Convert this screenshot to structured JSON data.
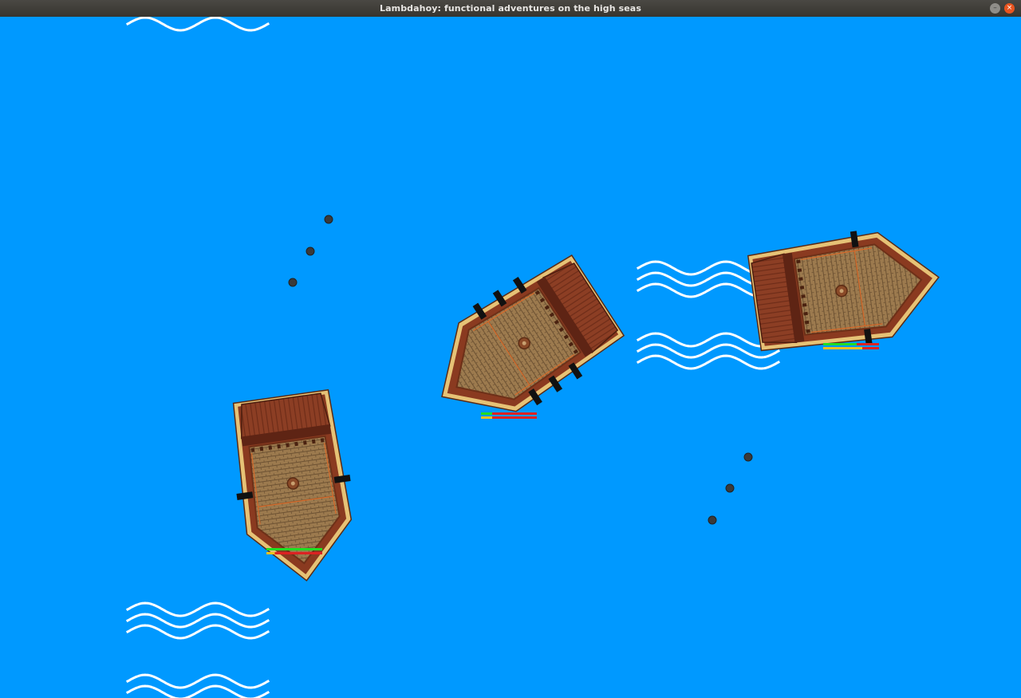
{
  "window": {
    "title": "Lambdahoy: functional adventures on the high seas",
    "minimize_glyph": "–",
    "close_glyph": "×"
  },
  "colors": {
    "sea": "#0099ff",
    "wave": "#ffffff",
    "hull_dark": "#8a3a20",
    "hull_trim": "#e6c276",
    "deck": "#9c7a4e",
    "cabin": "#8c3e24",
    "cannon": "#111111",
    "cannonball": "#3a3a3a",
    "health_full": "#22dd22",
    "health_missing": "#dd2222",
    "ammo_full": "#f0c020"
  },
  "ships": [
    {
      "name": "ship-bottom-left",
      "health": 1.0,
      "ammo": 0.15
    },
    {
      "name": "ship-center",
      "health": 0.2,
      "ammo": 0.2
    },
    {
      "name": "ship-right",
      "health": 0.6,
      "ammo": 0.7
    }
  ],
  "icons": {
    "wave": "wave-icon",
    "cannonball": "cannonball-icon",
    "cannon": "cannon-icon"
  }
}
